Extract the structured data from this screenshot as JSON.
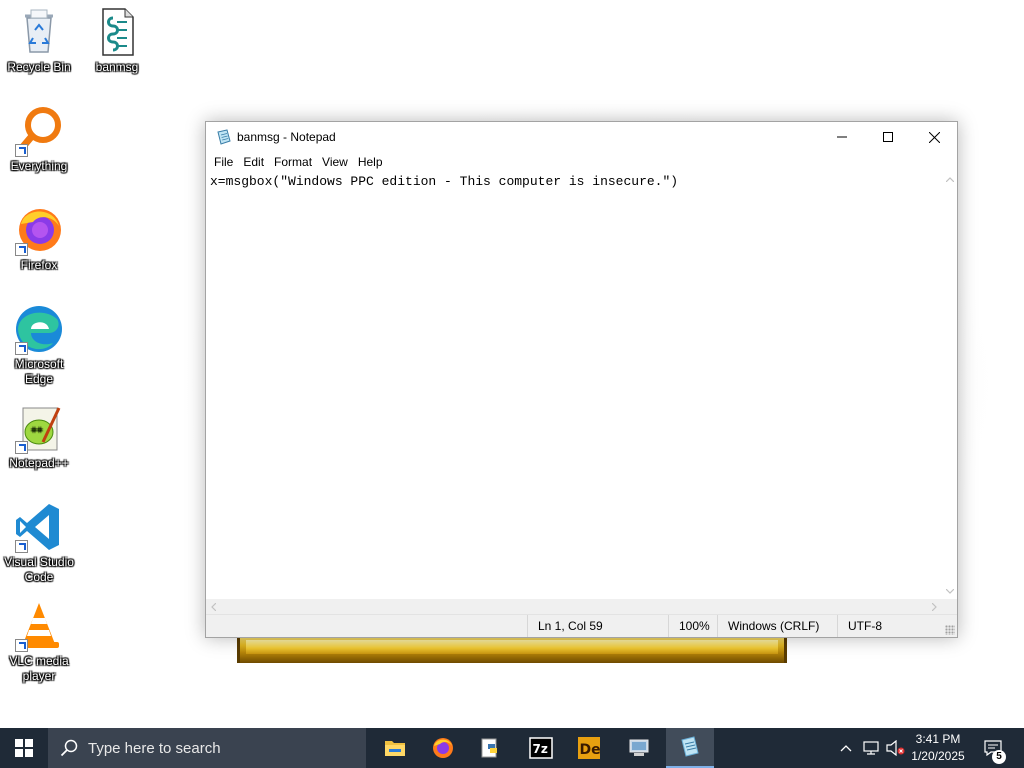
{
  "desktop_icons": [
    {
      "label": "Recycle Bin",
      "icon": "recycle-bin-icon"
    },
    {
      "label": "banmsg",
      "icon": "script-file-icon"
    },
    {
      "label": "Everything",
      "icon": "everything-search-icon"
    },
    {
      "label": "Firefox",
      "icon": "firefox-icon"
    },
    {
      "label": "Microsoft Edge",
      "icon": "edge-icon"
    },
    {
      "label": "Notepad++",
      "icon": "notepad-plus-plus-icon"
    },
    {
      "label": "Visual Studio Code",
      "icon": "vscode-icon"
    },
    {
      "label": "VLC media player",
      "icon": "vlc-icon"
    }
  ],
  "notepad": {
    "title": "banmsg - Notepad",
    "menu": [
      "File",
      "Edit",
      "Format",
      "View",
      "Help"
    ],
    "content": "x=msgbox(\"Windows PPC edition - This computer is insecure.\")",
    "status": {
      "position": "Ln 1, Col 59",
      "zoom": "100%",
      "line_ending": "Windows (CRLF)",
      "encoding": "UTF-8"
    }
  },
  "taskbar": {
    "search_placeholder": "Type here to search",
    "apps": [
      "file-explorer-icon",
      "firefox-icon",
      "python-icon",
      "7zip-icon",
      "de-app-icon",
      "computer-icon",
      "notepad-icon"
    ],
    "active_app": "notepad-icon",
    "clock_time": "3:41 PM",
    "clock_date": "1/20/2025",
    "notification_count": "5"
  },
  "colors": {
    "taskbar": "#1f2a37",
    "searchbox": "#3a4350",
    "active_app": "#414c5a",
    "accent": "#7fb0e8"
  }
}
